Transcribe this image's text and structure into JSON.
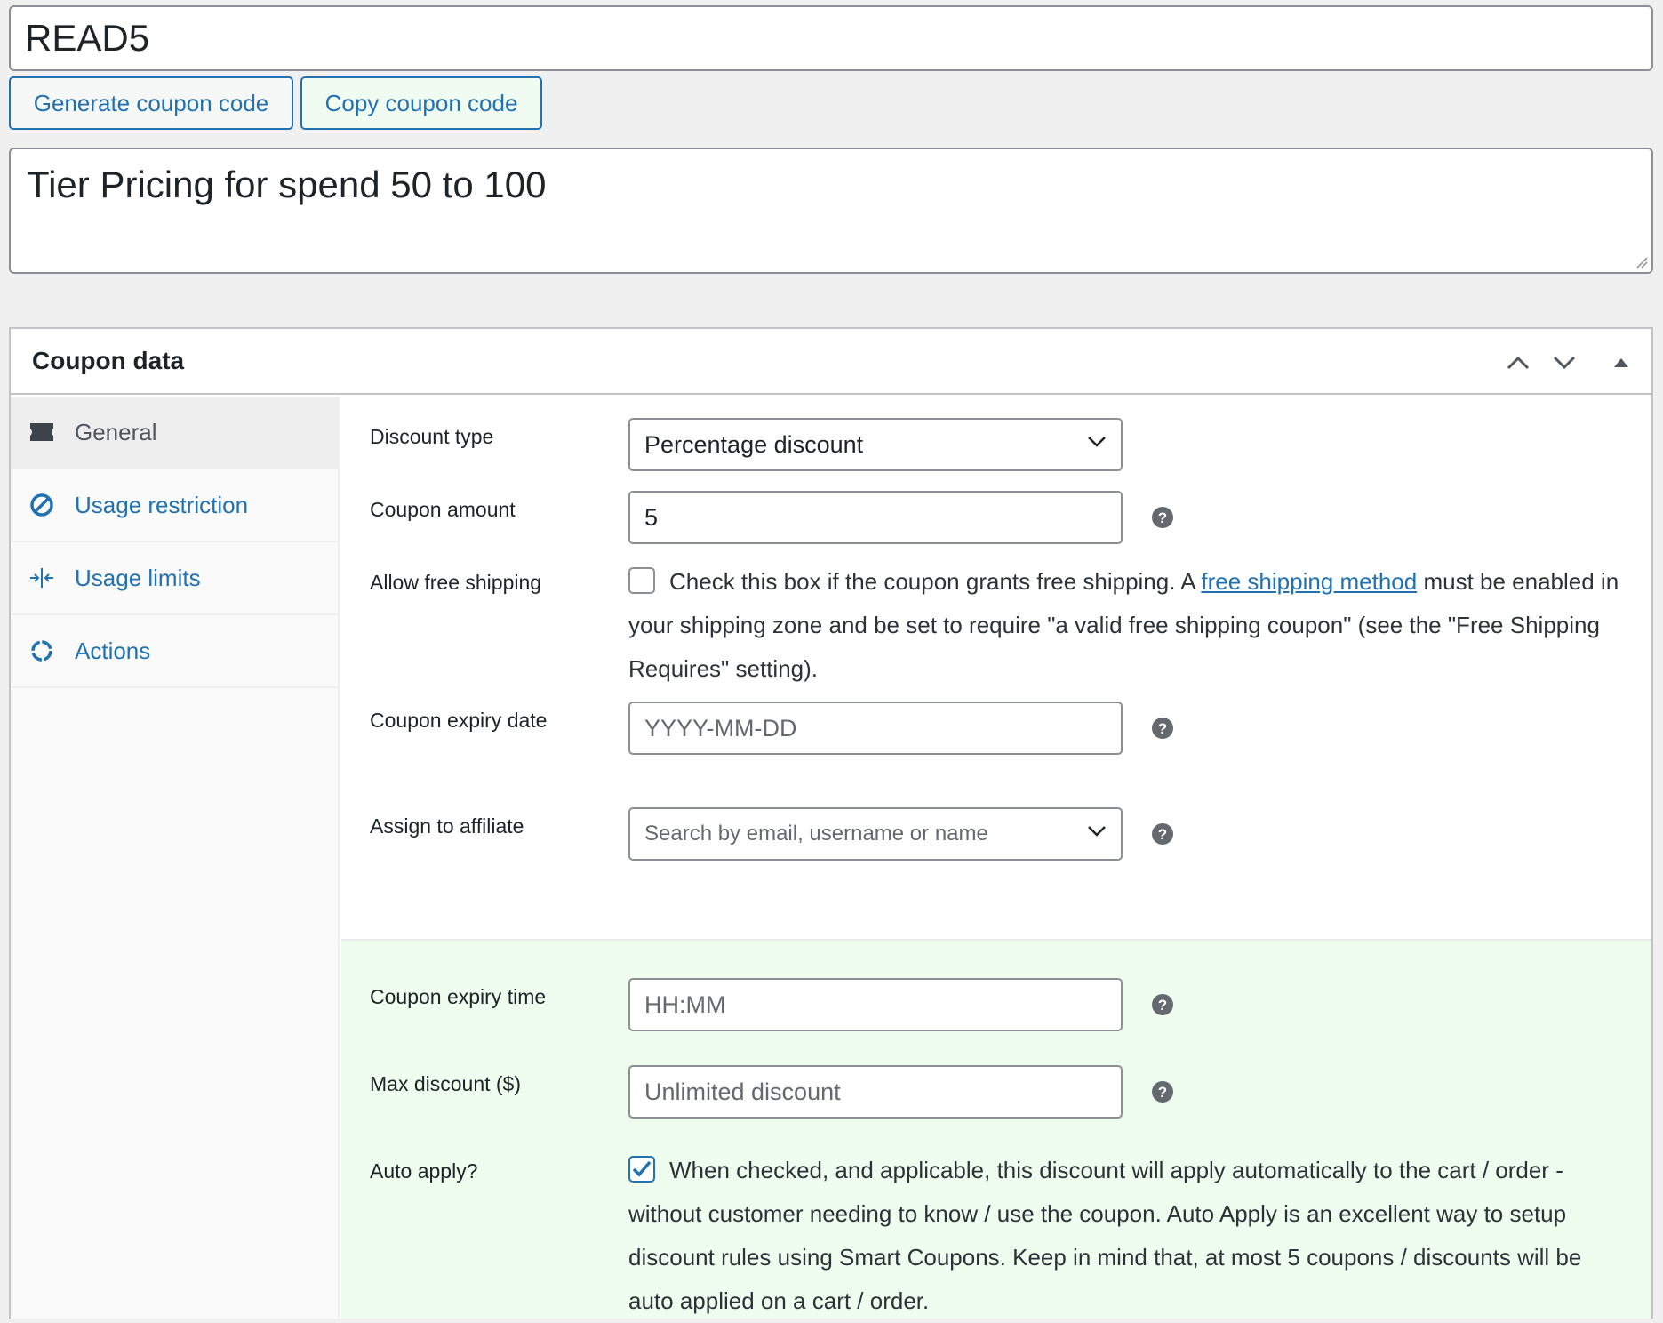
{
  "coupon": {
    "code": "READ5",
    "generate_button": "Generate coupon code",
    "copy_button": "Copy coupon code",
    "description": "Tier Pricing for spend 50 to 100"
  },
  "metabox": {
    "title": "Coupon data",
    "tabs": [
      {
        "label": "General",
        "icon": "ticket-icon"
      },
      {
        "label": "Usage restriction",
        "icon": "restricted-icon"
      },
      {
        "label": "Usage limits",
        "icon": "limits-icon"
      },
      {
        "label": "Actions",
        "icon": "actions-icon"
      }
    ]
  },
  "general": {
    "discount_type": {
      "label": "Discount type",
      "value": "Percentage discount"
    },
    "coupon_amount": {
      "label": "Coupon amount",
      "value": "5"
    },
    "free_shipping": {
      "label": "Allow free shipping",
      "text_before": "Check this box if the coupon grants free shipping. A",
      "link": "free shipping method",
      "text_after": "must be enabled in your shipping zone and be set to require \"a valid free shipping coupon\" (see the \"Free Shipping Requires\" setting).",
      "checked": false
    },
    "expiry_date": {
      "label": "Coupon expiry date",
      "placeholder": "YYYY-MM-DD"
    },
    "affiliate": {
      "label": "Assign to affiliate",
      "placeholder": "Search by email, username or name"
    }
  },
  "smart": {
    "expiry_time": {
      "label": "Coupon expiry time",
      "placeholder": "HH:MM"
    },
    "max_discount": {
      "label": "Max discount ($)",
      "placeholder": "Unlimited discount"
    },
    "auto_apply": {
      "label": "Auto apply?",
      "text": "When checked, and applicable, this discount will apply automatically to the cart / order - without customer needing to know / use the coupon. Auto Apply is an excellent way to setup discount rules using Smart Coupons. Keep in mind that, at most 5 coupons / discounts will be auto applied on a cart / order.",
      "checked": true
    }
  },
  "colors": {
    "accent": "#2271b1",
    "highlight_bg": "#effdef",
    "text": "#1d2327"
  }
}
